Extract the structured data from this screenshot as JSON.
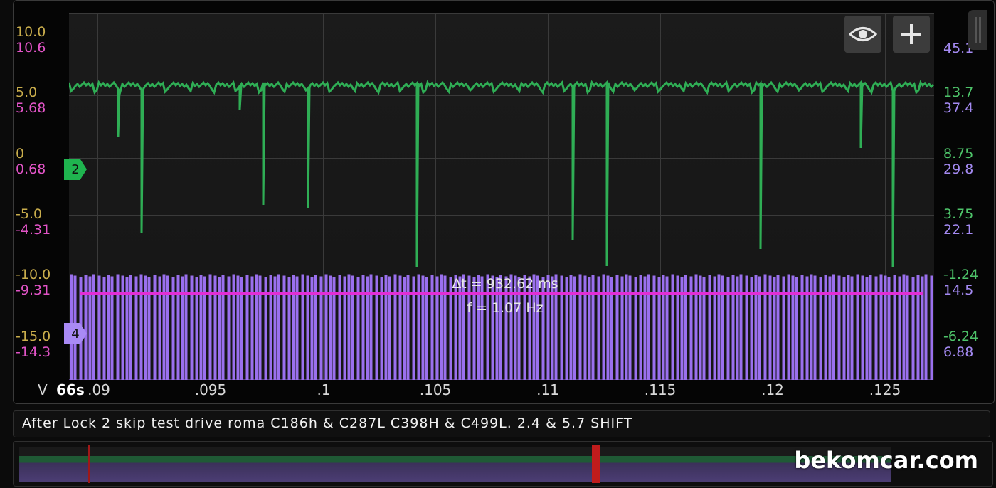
{
  "left_axis": {
    "labels_gold": [
      "10.0",
      "5.0",
      "0",
      "-5.0",
      "-10.0",
      "-15.0"
    ],
    "labels_pink": [
      "10.6",
      "5.68",
      "0.68",
      "-4.31",
      "-9.31",
      "-14.3"
    ]
  },
  "right_axis": {
    "labels_green": [
      "13.7",
      "8.75",
      "3.75",
      "-1.24",
      "-6.24"
    ],
    "labels_purple": [
      "45.1",
      "37.4",
      "29.8",
      "22.1",
      "14.5",
      "6.88"
    ]
  },
  "x_axis": {
    "unit": "V",
    "time": "66s",
    "ticks": [
      ".09",
      ".095",
      ".1",
      ".105",
      ".11",
      ".115",
      ".12",
      ".125"
    ]
  },
  "channels": {
    "green_marker": "2",
    "purple_marker": "4",
    "green_color": "#2fae55",
    "purple_color": "#9a70ee",
    "cursor_color": "#e22ed5"
  },
  "measurement": {
    "delta_t": "Δt = 932.62 ms",
    "frequency": "f = 1.07 Hz"
  },
  "toolbar": {
    "eye_icon": "eye-icon",
    "plus_icon": "plus-icon"
  },
  "caption": "After Lock 2 skip test drive roma C186h & C287L C398H & C499L.  2.4 & 5.7 SHIFT",
  "watermark": "bekomcar.com"
}
